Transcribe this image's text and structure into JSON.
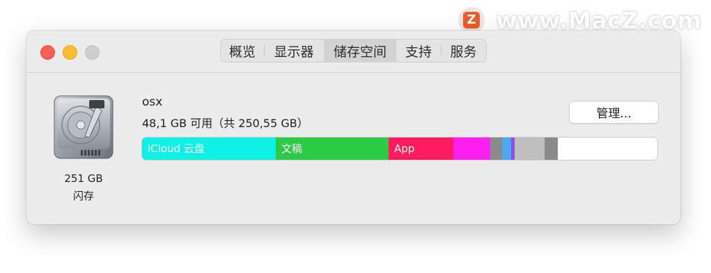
{
  "watermark": {
    "logo_letter": "Z",
    "text": "www.MacZ.com"
  },
  "window": {
    "traffic_lights": [
      "close",
      "minimize",
      "zoom"
    ],
    "tabs": [
      {
        "label": "概览",
        "selected": false
      },
      {
        "label": "显示器",
        "selected": false
      },
      {
        "label": "储存空间",
        "selected": true
      },
      {
        "label": "支持",
        "selected": false
      },
      {
        "label": "服务",
        "selected": false
      }
    ]
  },
  "drive": {
    "icon": "hard-drive-icon",
    "capacity": "251 GB",
    "type": "闪存"
  },
  "volume": {
    "name": "osx",
    "available": "48,1 GB 可用（共 250,55 GB）"
  },
  "manage_button": {
    "label": "管理..."
  },
  "storage_bar": {
    "segments": [
      {
        "label": "iCloud 云盘",
        "color": "#0ff0e6"
      },
      {
        "label": "文稿",
        "color": "#2ccb46"
      },
      {
        "label": "App",
        "color": "#ff1c5e"
      },
      {
        "label": "",
        "color": "#ff1ef0"
      },
      {
        "label": "",
        "color": "#8a8a8a"
      },
      {
        "label": "",
        "color": "#4ba9f2"
      },
      {
        "label": "",
        "color": "#8b4ee8"
      },
      {
        "label": "",
        "color": "#bfbfbf"
      },
      {
        "label": "",
        "color": "#8a8a8a"
      },
      {
        "label": "",
        "color": "#ffffff"
      }
    ]
  }
}
